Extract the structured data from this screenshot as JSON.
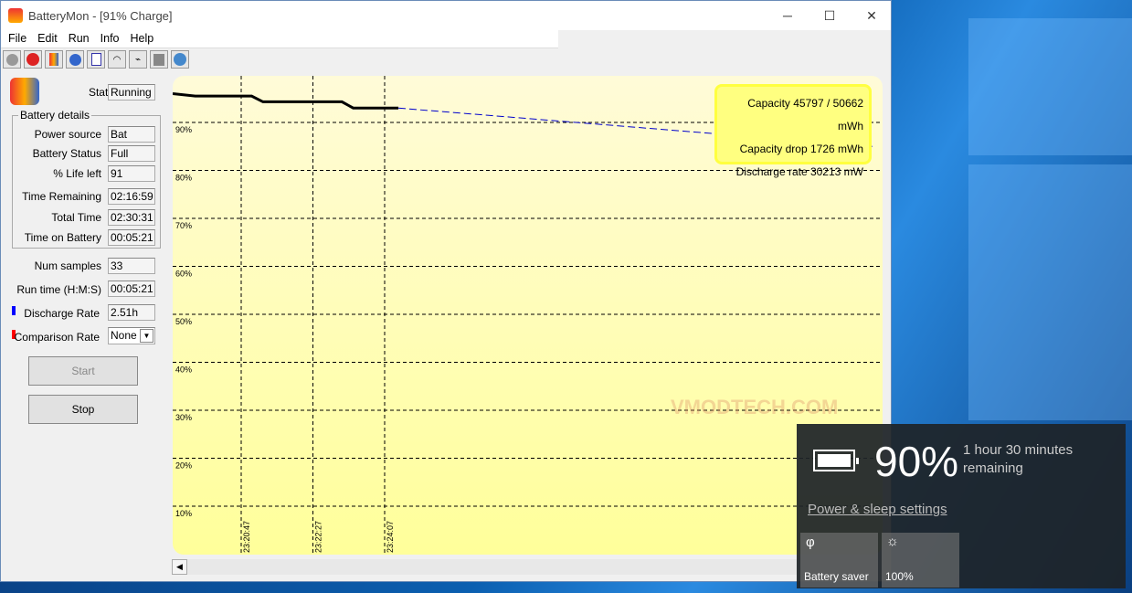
{
  "window": {
    "title": "BatteryMon - [91% Charge]",
    "minimize": "─",
    "maximize": "☐",
    "close": "✕"
  },
  "menu": [
    "File",
    "Edit",
    "Run",
    "Info",
    "Help"
  ],
  "toolbar": [
    "record-icon",
    "stop-icon",
    "battery-icon",
    "settings-icon",
    "checklist-icon",
    "gauge-icon",
    "plug-icon",
    "puzzle-icon",
    "help-icon"
  ],
  "panel": {
    "status_label": "Status",
    "status": "Running",
    "group_label": "Battery details",
    "rows": [
      {
        "label": "Power source",
        "value": "Bat"
      },
      {
        "label": "Battery Status",
        "value": "Full"
      },
      {
        "label": "% Life left",
        "value": "91"
      },
      {
        "label": "Time Remaining",
        "value": "02:16:59"
      },
      {
        "label": "Total Time",
        "value": "02:30:31"
      },
      {
        "label": "Time on Battery",
        "value": "00:05:21"
      }
    ],
    "num_samples_label": "Num samples",
    "num_samples": "33",
    "run_time_label": "Run time (H:M:S)",
    "run_time": "00:05:21",
    "discharge_label": "Discharge Rate",
    "discharge": "2.51h",
    "discharge_color": "#0000ff",
    "comparison_label": "Comparison Rate",
    "comparison": "None",
    "comparison_color": "#ff0000",
    "start": "Start",
    "stop": "Stop"
  },
  "chart_data": {
    "type": "line",
    "y_ticks": [
      "90%",
      "80%",
      "70%",
      "60%",
      "50%",
      "40%",
      "30%",
      "20%",
      "10%"
    ],
    "x_ticks": [
      "23:20:47",
      "23:22:27",
      "23:24:07"
    ],
    "ylim": [
      0,
      100
    ],
    "grid": true,
    "series": [
      {
        "color": "#000000",
        "points": [
          [
            0,
            96
          ],
          [
            0.1,
            95.5
          ],
          [
            0.35,
            95.5
          ],
          [
            0.4,
            94.3
          ],
          [
            0.75,
            94.3
          ],
          [
            0.8,
            93
          ],
          [
            1.0,
            93
          ]
        ]
      },
      {
        "color": "#0000cc",
        "dashed": true,
        "points": [
          [
            1.0,
            93
          ],
          [
            3.1,
            85
          ]
        ]
      }
    ],
    "info": [
      "Capacity 45797 / 50662 mWh",
      "Capacity drop 1726 mWh",
      "Discharge rate 30213 mW"
    ]
  },
  "watermark": "VMODTECH.COM",
  "flyout": {
    "percent": "90%",
    "remaining": "1 hour 30 minutes remaining",
    "link": "Power & sleep settings",
    "tiles": [
      {
        "icon": "leaf-icon",
        "label": "Battery saver",
        "glyph": "φ"
      },
      {
        "icon": "brightness-icon",
        "label": "100%",
        "glyph": "☼"
      }
    ]
  }
}
